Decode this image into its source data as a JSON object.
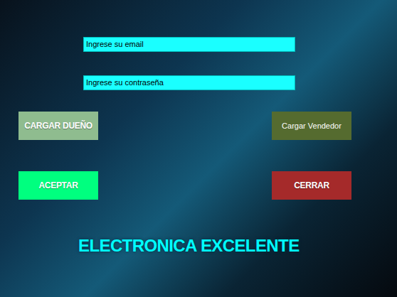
{
  "form": {
    "fields": [
      {
        "text": "Ingrese su email"
      },
      {
        "text": "Ingrese su contraseña"
      }
    ]
  },
  "button_rows": [
    [
      {
        "label": "CARGAR DUEÑO",
        "kind": "display",
        "color": "#8fbc8f"
      },
      {
        "label": "Cargar Vendedor",
        "kind": "normal",
        "color": "#556b2f"
      }
    ],
    [
      {
        "label": "ACEPTAR",
        "kind": "display",
        "color": "#00ff7f"
      },
      {
        "label": "CERRAR",
        "kind": "display",
        "color": "#a52a2a"
      }
    ]
  ],
  "title": "ELECTRONICA EXCELENTE"
}
